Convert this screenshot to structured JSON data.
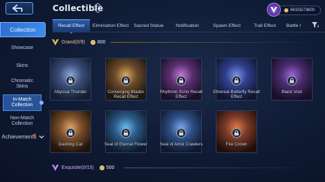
{
  "header": {
    "title": "Collectible",
    "help_symbol": "?",
    "points": "66155/73600"
  },
  "sidebar": {
    "collection": "Collection",
    "items": [
      {
        "label": "Showcase"
      },
      {
        "label": "Skins"
      },
      {
        "label": "Chromatic Skins"
      },
      {
        "label": "In-Match Collection",
        "active": true
      },
      {
        "label": "Non-Match Collection"
      }
    ],
    "achievements": "Achievements"
  },
  "tabs": [
    {
      "label": "Recall Effect",
      "active": true
    },
    {
      "label": "Elimination Effect"
    },
    {
      "label": "Sacred Statue"
    },
    {
      "label": "Notification"
    },
    {
      "label": "Spawn Effect"
    },
    {
      "label": "Trail Effect"
    },
    {
      "label": "Battle I"
    }
  ],
  "sections": {
    "grand": {
      "label": "Grand(0/9)",
      "points": "800",
      "color": "#e8c98a"
    },
    "exquisite": {
      "label": "Exquisite(0/15)",
      "points": "500",
      "color": "#d2b6ff"
    }
  },
  "cards": [
    {
      "name": "Abyssal Thunder",
      "tint": "#3b4f7a"
    },
    {
      "name": "Converging Blades Recall Effect",
      "tint": "#6a4a2a"
    },
    {
      "name": "Rhythmic Echo Recall Effect",
      "tint": "#5a2f6e"
    },
    {
      "name": "Ethereal Butterfly Recall Effect",
      "tint": "#2f3f8a"
    },
    {
      "name": "Black Void",
      "tint": "#4a2c6e"
    },
    {
      "name": "Dashing Cat",
      "tint": "#7a4f2a"
    },
    {
      "name": "Seal of Eternal Flower",
      "tint": "#2c5a88"
    },
    {
      "name": "Seal of Amoi Crawlers",
      "tint": "#2f4f86"
    },
    {
      "name": "Fire Crown",
      "tint": "#7a3a28"
    }
  ],
  "colors": {
    "accent": "#3c8bea",
    "gold": "#e8c98a"
  }
}
